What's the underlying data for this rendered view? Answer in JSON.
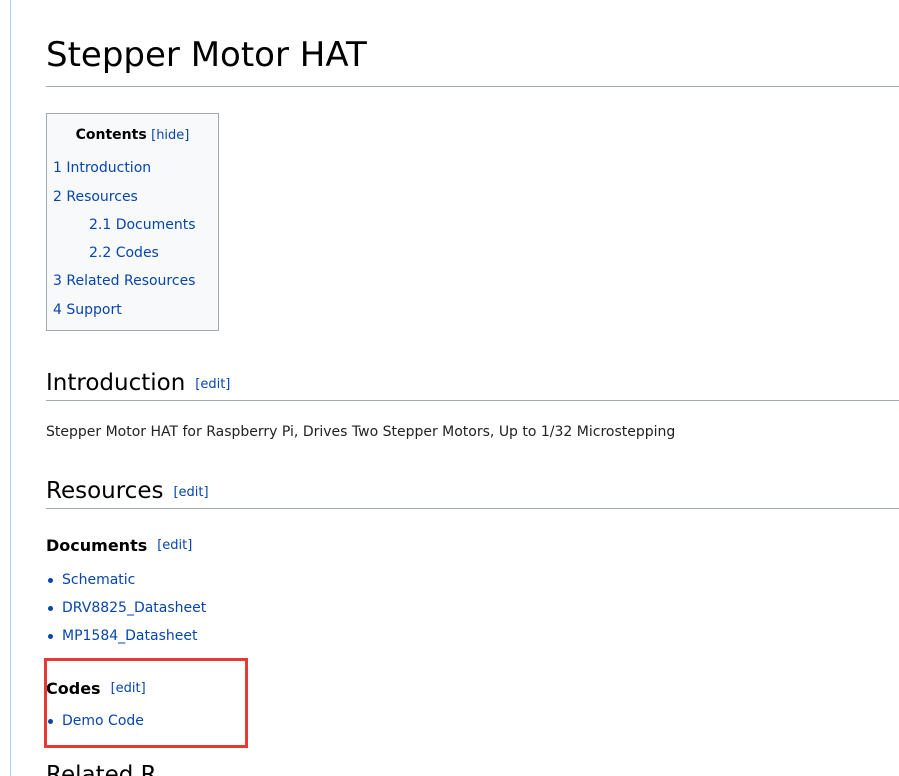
{
  "page": {
    "title": "Stepper Motor HAT"
  },
  "toc": {
    "title": "Contents",
    "hide_label": "[hide]",
    "items": [
      {
        "label": "1 Introduction"
      },
      {
        "label": "2 Resources"
      },
      {
        "label": "2.1 Documents"
      },
      {
        "label": "2.2 Codes"
      },
      {
        "label": "3 Related Resources"
      },
      {
        "label": "4 Support"
      }
    ]
  },
  "sections": {
    "introduction": {
      "heading": "Introduction",
      "edit_label": "[edit]",
      "text": "Stepper Motor HAT for Raspberry Pi, Drives Two Stepper Motors, Up to 1/32 Microstepping"
    },
    "resources": {
      "heading": "Resources",
      "edit_label": "[edit]"
    },
    "documents": {
      "heading": "Documents",
      "edit_label": "[edit]",
      "links": [
        {
          "label": "Schematic"
        },
        {
          "label": "DRV8825_Datasheet"
        },
        {
          "label": "MP1584_Datasheet"
        }
      ]
    },
    "codes": {
      "heading": "Codes",
      "edit_label": "[edit]",
      "links": [
        {
          "label": "Demo Code"
        }
      ]
    },
    "related": {
      "heading_partial": "Related R"
    }
  },
  "colors": {
    "link": "#0645ad",
    "rule": "#a2a9b1",
    "highlight": "#e53935"
  }
}
